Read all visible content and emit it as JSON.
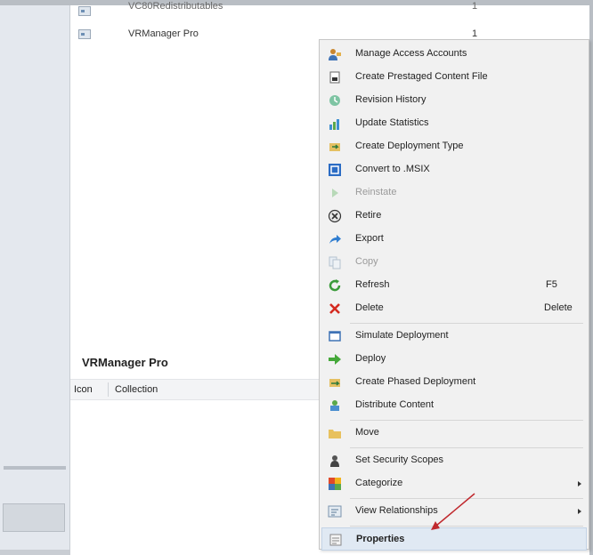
{
  "list": {
    "rows": [
      {
        "name": "VC80Redistributables",
        "count": "1"
      },
      {
        "name": "VRManager Pro",
        "count": "1"
      }
    ]
  },
  "details": {
    "title": "VRManager Pro",
    "columns": [
      "Icon",
      "Collection"
    ]
  },
  "context_menu": {
    "items": [
      {
        "label": "Manage Access Accounts",
        "icon": "access-accounts-icon"
      },
      {
        "label": "Create Prestaged Content File",
        "icon": "prestaged-content-icon"
      },
      {
        "label": "Revision History",
        "icon": "revision-history-icon"
      },
      {
        "label": "Update Statistics",
        "icon": "update-statistics-icon"
      },
      {
        "label": "Create Deployment Type",
        "icon": "deployment-type-icon"
      },
      {
        "label": "Convert to .MSIX",
        "icon": "msix-icon"
      },
      {
        "label": "Reinstate",
        "icon": "reinstate-icon",
        "disabled": true
      },
      {
        "label": "Retire",
        "icon": "retire-icon"
      },
      {
        "label": "Export",
        "icon": "export-icon"
      },
      {
        "label": "Copy",
        "icon": "copy-icon",
        "disabled": true
      },
      {
        "label": "Refresh",
        "icon": "refresh-icon",
        "shortcut": "F5"
      },
      {
        "label": "Delete",
        "icon": "delete-icon",
        "shortcut": "Delete"
      },
      {
        "label": "Simulate Deployment",
        "icon": "simulate-deployment-icon"
      },
      {
        "label": "Deploy",
        "icon": "deploy-icon"
      },
      {
        "label": "Create Phased Deployment",
        "icon": "phased-deployment-icon"
      },
      {
        "label": "Distribute Content",
        "icon": "distribute-content-icon"
      },
      {
        "label": "Move",
        "icon": "move-icon"
      },
      {
        "label": "Set Security Scopes",
        "icon": "security-scopes-icon"
      },
      {
        "label": "Categorize",
        "icon": "categorize-icon",
        "submenu": true
      },
      {
        "label": "View Relationships",
        "icon": "relationships-icon",
        "submenu": true
      },
      {
        "label": "Properties",
        "icon": "properties-icon",
        "highlighted": true
      }
    ]
  },
  "annotation": {
    "color": "#c0282d"
  }
}
